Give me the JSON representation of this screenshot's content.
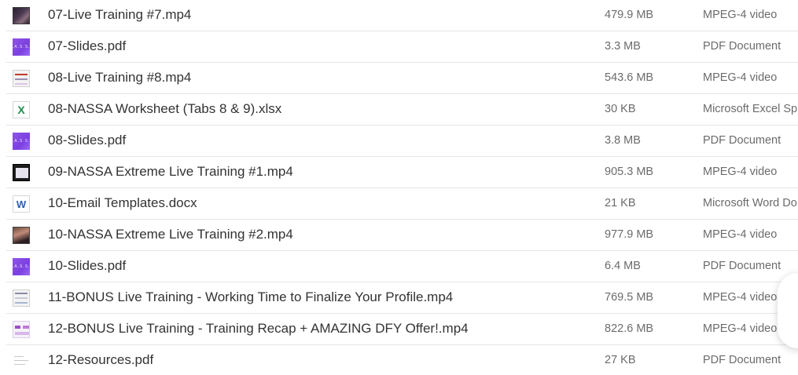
{
  "files": [
    {
      "name": "07-Live Training #7.mp4",
      "size": "479.9 MB",
      "kind": "MPEG-4 video",
      "icon": "video-thumbnail-icon"
    },
    {
      "name": "07-Slides.pdf",
      "size": "3.3 MB",
      "kind": "PDF Document",
      "icon": "slides-thumbnail-icon",
      "thumb_text": "N.A.S.S.A"
    },
    {
      "name": "08-Live Training #8.mp4",
      "size": "543.6 MB",
      "kind": "MPEG-4 video",
      "icon": "video-thumbnail-icon"
    },
    {
      "name": "08-NASSA Worksheet (Tabs 8 & 9).xlsx",
      "size": "30 KB",
      "kind": "Microsoft Excel Sp",
      "icon": "excel-icon",
      "thumb_text": "X"
    },
    {
      "name": "08-Slides.pdf",
      "size": "3.8 MB",
      "kind": "PDF Document",
      "icon": "slides-thumbnail-icon",
      "thumb_text": "N.A.S.S.A"
    },
    {
      "name": "09-NASSA Extreme Live Training #1.mp4",
      "size": "905.3 MB",
      "kind": "MPEG-4 video",
      "icon": "video-thumbnail-icon"
    },
    {
      "name": "10-Email Templates.docx",
      "size": "21 KB",
      "kind": "Microsoft Word Do",
      "icon": "word-icon",
      "thumb_text": "W"
    },
    {
      "name": "10-NASSA Extreme Live Training #2.mp4",
      "size": "977.9 MB",
      "kind": "MPEG-4 video",
      "icon": "video-thumbnail-icon"
    },
    {
      "name": "10-Slides.pdf",
      "size": "6.4 MB",
      "kind": "PDF Document",
      "icon": "slides-thumbnail-icon",
      "thumb_text": "N.A.S.S.A"
    },
    {
      "name": "11-BONUS Live Training - Working Time to Finalize Your Profile.mp4",
      "size": "769.5 MB",
      "kind": "MPEG-4 video",
      "icon": "video-thumbnail-icon"
    },
    {
      "name": "12-BONUS Live Training - Training Recap + AMAZING DFY Offer!.mp4",
      "size": "822.6 MB",
      "kind": "MPEG-4 video",
      "icon": "video-thumbnail-icon"
    },
    {
      "name": "12-Resources.pdf",
      "size": "27 KB",
      "kind": "PDF Document",
      "icon": "document-thumbnail-icon"
    }
  ],
  "colors": {
    "text_primary": "#333333",
    "text_secondary": "#6b6b6b",
    "divider": "#e6e6e6",
    "slides_purple": "#7b3fe0",
    "excel_green": "#1f8f4e",
    "word_blue": "#2b5fb4"
  }
}
